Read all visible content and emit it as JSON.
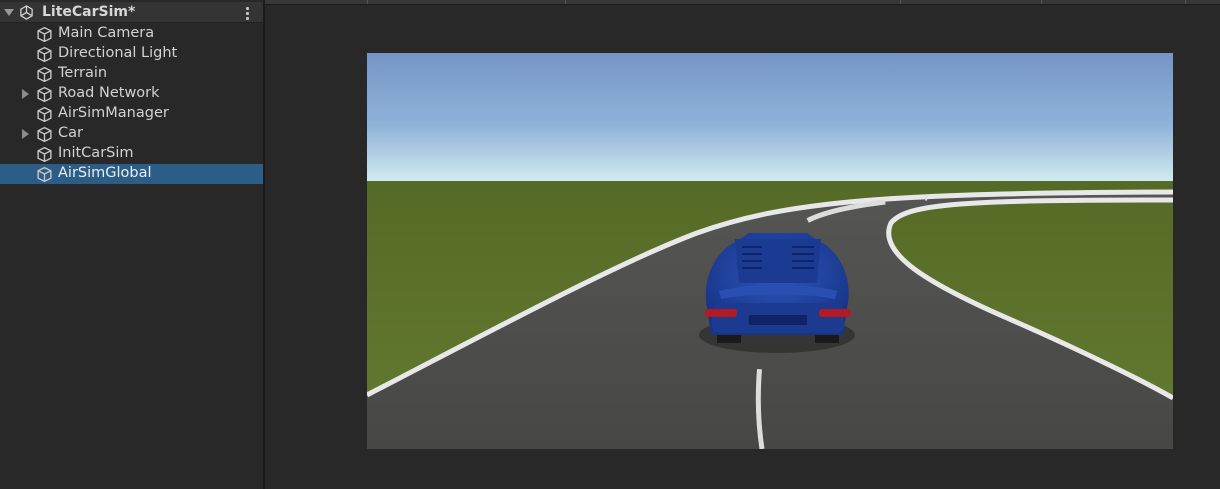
{
  "hierarchy": {
    "scene": {
      "name": "LiteCarSim*",
      "expanded": true
    },
    "items": [
      {
        "label": "Main Camera",
        "has_children": false,
        "selected": false
      },
      {
        "label": "Directional Light",
        "has_children": false,
        "selected": false
      },
      {
        "label": "Terrain",
        "has_children": false,
        "selected": false
      },
      {
        "label": "Road Network",
        "has_children": true,
        "selected": false
      },
      {
        "label": "AirSimManager",
        "has_children": false,
        "selected": false
      },
      {
        "label": "Car",
        "has_children": true,
        "selected": false
      },
      {
        "label": "InitCarSim",
        "has_children": false,
        "selected": false
      },
      {
        "label": "AirSimGlobal",
        "has_children": false,
        "selected": true
      }
    ]
  },
  "colors": {
    "panel_bg": "#282828",
    "selection": "#2c5d87",
    "sky_top": "#7596c5",
    "sky_horizon": "#cde6ee",
    "grass": "#5b6e2a",
    "road": "#4a4a48",
    "car_body": "#1f3f9d"
  },
  "icons": {
    "scene": "unity-scene-icon",
    "menu": "kebab-menu-icon",
    "gameobject": "cube-icon",
    "fold": "triangle-fold-icon"
  }
}
